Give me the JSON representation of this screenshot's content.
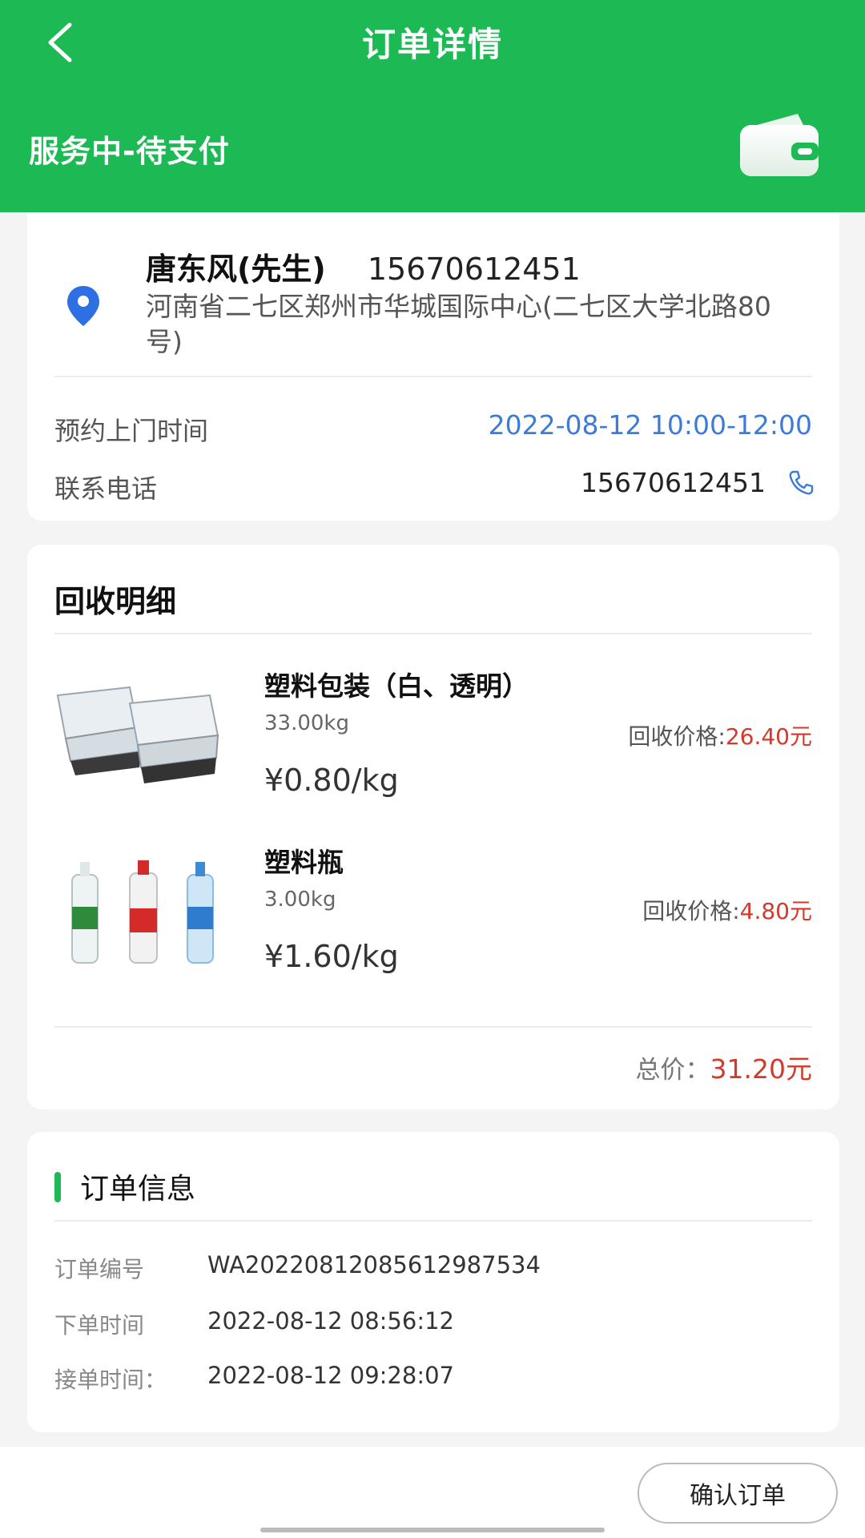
{
  "header": {
    "title": "订单详情",
    "status": "服务中-待支付",
    "accent_color": "#1db954",
    "back_icon": "chevron-left-icon",
    "wallet_icon": "wallet-icon"
  },
  "address_card": {
    "name": "唐东风(先生)",
    "phone": "15670612451",
    "address": "河南省二七区郑州市华城国际中心(二七区大学北路80号)",
    "appointment_label": "预约上门时间",
    "appointment_value": "2022-08-12 10:00-12:00",
    "contact_label": "联系电话",
    "contact_value": "15670612451"
  },
  "detail_card": {
    "title": "回收明细",
    "items": [
      {
        "name": "塑料包装（白、透明）",
        "weight": "33.00kg",
        "unit_price": "¥0.80/kg",
        "recycle_label": "回收价格:",
        "recycle_amount": "26.40元"
      },
      {
        "name": "塑料瓶",
        "weight": "3.00kg",
        "unit_price": "¥1.60/kg",
        "recycle_label": "回收价格:",
        "recycle_amount": "4.80元"
      }
    ],
    "total_label": "总价：",
    "total_amount": "31.20元"
  },
  "info_card": {
    "title": "订单信息",
    "rows": [
      {
        "label": "订单编号",
        "value": "WA2022081208561298753 4"
      },
      {
        "label": "下单时间",
        "value": "2022-08-12 08:56:12"
      },
      {
        "label": "接单时间：",
        "value": "2022-08-12 09:28:07"
      }
    ]
  },
  "bottom": {
    "confirm_label": "确认订单"
  }
}
